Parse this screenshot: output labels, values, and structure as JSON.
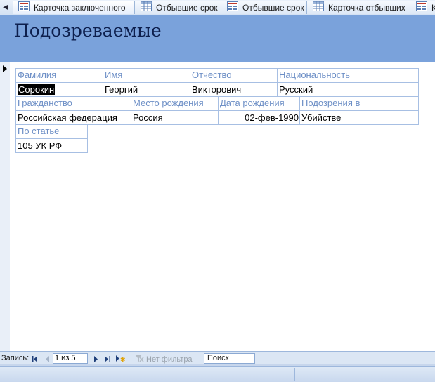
{
  "tabs": [
    {
      "label": "Карточка заключенного",
      "icon": "form-icon",
      "active": true
    },
    {
      "label": "Отбывшие срок",
      "icon": "table-icon"
    },
    {
      "label": "Отбывшие срок",
      "icon": "form-icon"
    },
    {
      "label": "Карточка отбывших",
      "icon": "table-icon"
    },
    {
      "label": "К",
      "icon": "form-icon"
    }
  ],
  "form": {
    "title": "Подозреваемые",
    "fields": {
      "surname": {
        "label": "Фамилия",
        "value": "Сорокин"
      },
      "name": {
        "label": "Имя",
        "value": "Георгий"
      },
      "patronymic": {
        "label": "Отчество",
        "value": "Викторович"
      },
      "nationality": {
        "label": "Национальность",
        "value": "Русский"
      },
      "citizenship": {
        "label": "Гражданство",
        "value": "Российская федерация"
      },
      "birthplace": {
        "label": "Место рождения",
        "value": "Россия"
      },
      "birthdate": {
        "label": "Дата рождения",
        "value": "02-фев-1990"
      },
      "suspected": {
        "label": "Подозрения в",
        "value": "Убийстве"
      },
      "article": {
        "label": "По статье",
        "value": "105 УК РФ"
      }
    }
  },
  "navigation": {
    "record_label": "Запись:",
    "record_position": "1 из 5",
    "filter_label": "Нет фильтра",
    "search_label": "Поиск"
  },
  "colors": {
    "header_bg": "#7aa2db",
    "label_text": "#6d8fc6",
    "title_text": "#0d1f4d"
  }
}
